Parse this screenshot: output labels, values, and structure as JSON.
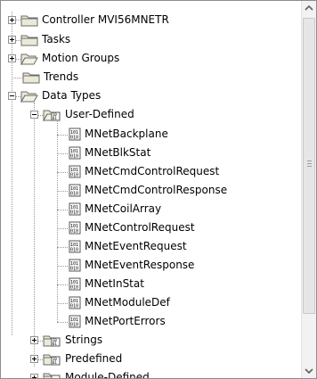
{
  "tree": {
    "controller": "Controller MVI56MNETR",
    "tasks": "Tasks",
    "motion_groups": "Motion Groups",
    "trends": "Trends",
    "data_types": "Data Types",
    "user_defined": "User-Defined",
    "user_defined_items": [
      "MNetBackplane",
      "MNetBlkStat",
      "MNetCmdControlRequest",
      "MNetCmdControlResponse",
      "MNetCoilArray",
      "MNetControlRequest",
      "MNetEventRequest",
      "MNetEventResponse",
      "MNetInStat",
      "MNetModuleDef",
      "MNetPortErrors"
    ],
    "strings": "Strings",
    "predefined": "Predefined",
    "module_defined": "Module-Defined"
  },
  "icons": {
    "folder": "folder-icon",
    "datatype": "data-type-icon"
  },
  "colors": {
    "folder_fill": "#ece9d8",
    "folder_stroke": "#6b6b6b",
    "tree_lines": "#9a9a9a",
    "scrollbar": "#f2f2f2"
  }
}
